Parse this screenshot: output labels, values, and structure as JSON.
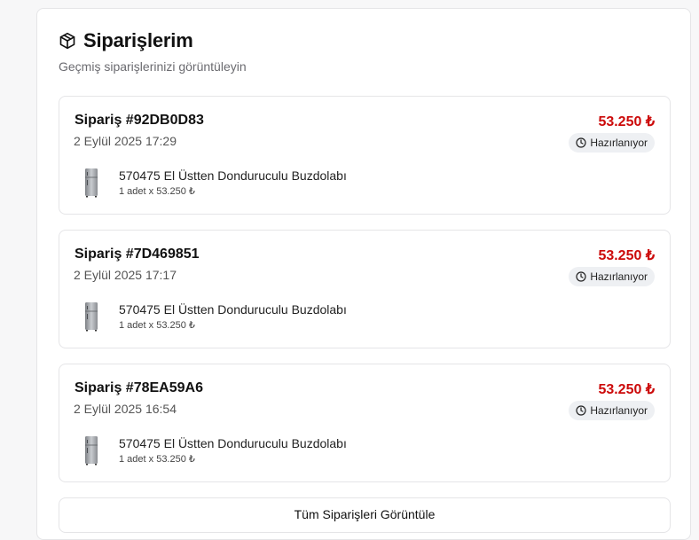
{
  "header": {
    "icon": "package-icon",
    "title": "Siparişlerim",
    "subtitle": "Geçmiş siparişlerinizi görüntüleyin"
  },
  "orders": [
    {
      "id": "Sipariş #92DB0D83",
      "date": "2 Eylül 2025 17:29",
      "total": "53.250 ₺",
      "status": "Hazırlanıyor",
      "status_icon": "clock-icon",
      "item": {
        "thumb": "refrigerator-thumbnail",
        "name": "570475 El Üstten Donduruculu Buzdolabı",
        "qty": "1 adet x 53.250 ₺"
      }
    },
    {
      "id": "Sipariş #7D469851",
      "date": "2 Eylül 2025 17:17",
      "total": "53.250 ₺",
      "status": "Hazırlanıyor",
      "status_icon": "clock-icon",
      "item": {
        "thumb": "refrigerator-thumbnail",
        "name": "570475 El Üstten Donduruculu Buzdolabı",
        "qty": "1 adet x 53.250 ₺"
      }
    },
    {
      "id": "Sipariş #78EA59A6",
      "date": "2 Eylül 2025 16:54",
      "total": "53.250 ₺",
      "status": "Hazırlanıyor",
      "status_icon": "clock-icon",
      "item": {
        "thumb": "refrigerator-thumbnail",
        "name": "570475 El Üstten Donduruculu Buzdolabı",
        "qty": "1 adet x 53.250 ₺"
      }
    }
  ],
  "view_all_label": "Tüm Siparişleri Görüntüle",
  "colors": {
    "price": "#cc0a0a",
    "badge_bg": "#eef0f3",
    "border": "#e5e5e7"
  }
}
